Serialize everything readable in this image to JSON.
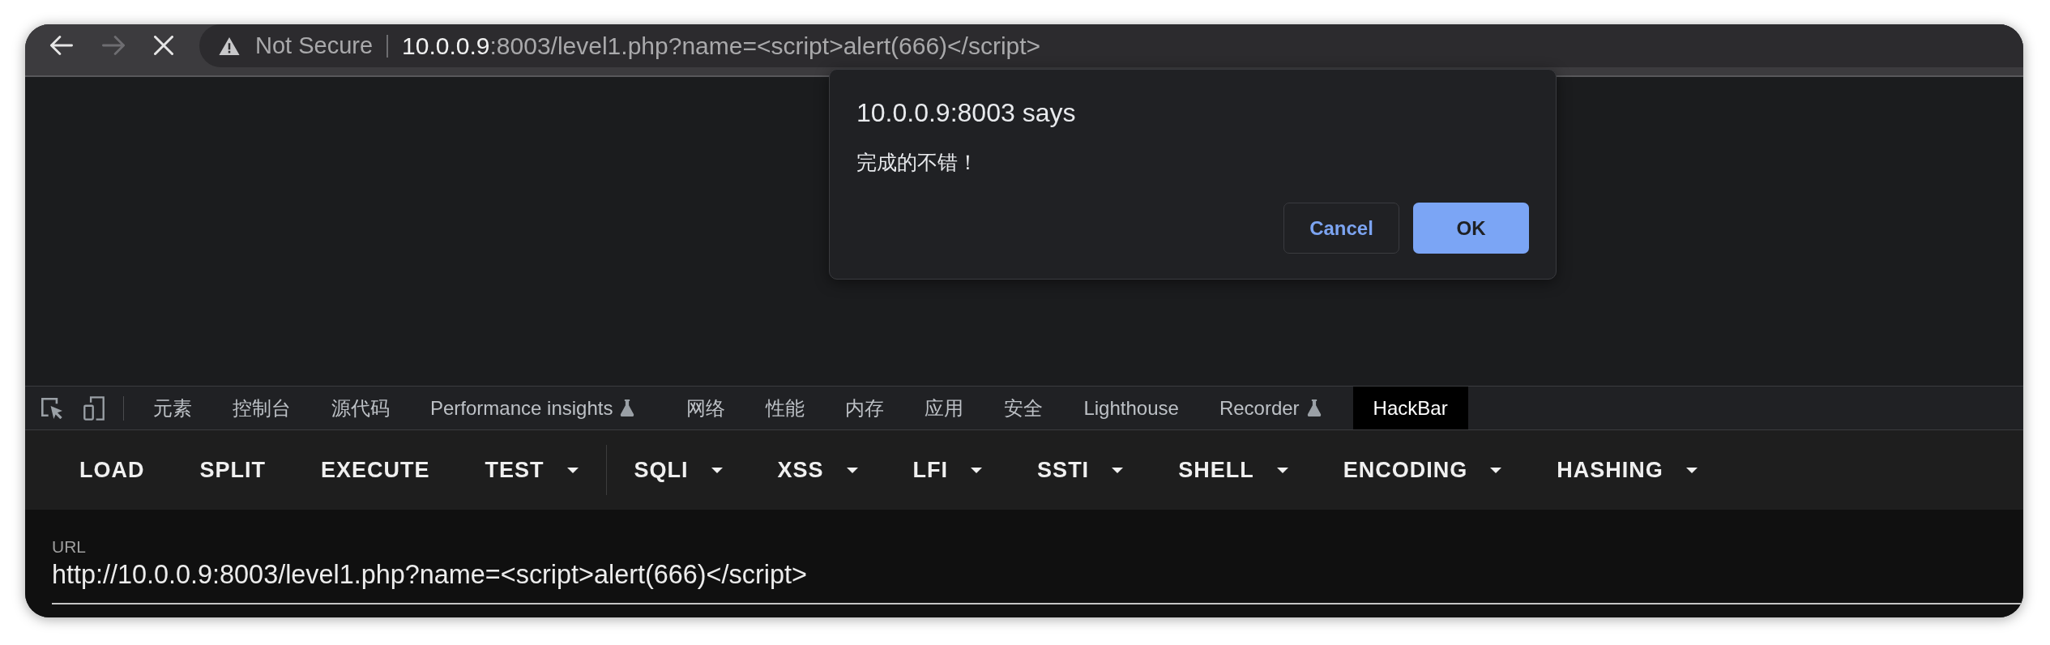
{
  "toolbar": {
    "buttons": [
      {
        "kind": "back",
        "disabled": false
      },
      {
        "kind": "forward",
        "disabled": true
      },
      {
        "kind": "stop",
        "disabled": false
      }
    ],
    "address_bar": {
      "security_label": "Not Secure",
      "host": "10.0.0.9",
      "path": ":8003/level1.php?name=<script>alert(666)</script>"
    }
  },
  "dialog": {
    "title": "10.0.0.9:8003 says",
    "message": "完成的不错！",
    "buttons": [
      {
        "label": "Cancel",
        "kind": "cancel"
      },
      {
        "label": "OK",
        "kind": "confirm"
      }
    ]
  },
  "devtools": {
    "tabs": [
      {
        "label": "元素",
        "selected": false,
        "experimental": false
      },
      {
        "label": "控制台",
        "selected": false,
        "experimental": false
      },
      {
        "label": "源代码",
        "selected": false,
        "experimental": false
      },
      {
        "label": "Performance insights",
        "selected": false,
        "experimental": true
      },
      {
        "label": "网络",
        "selected": false,
        "experimental": false
      },
      {
        "label": "性能",
        "selected": false,
        "experimental": false
      },
      {
        "label": "内存",
        "selected": false,
        "experimental": false
      },
      {
        "label": "应用",
        "selected": false,
        "experimental": false
      },
      {
        "label": "安全",
        "selected": false,
        "experimental": false
      },
      {
        "label": "Lighthouse",
        "selected": false,
        "experimental": false
      },
      {
        "label": "Recorder",
        "selected": false,
        "experimental": true
      },
      {
        "label": "HackBar",
        "selected": true,
        "experimental": false
      }
    ]
  },
  "hackbar": {
    "groups": [
      {
        "buttons": [
          {
            "label": "LOAD",
            "dropdown": false
          },
          {
            "label": "SPLIT",
            "dropdown": false
          },
          {
            "label": "EXECUTE",
            "dropdown": false
          },
          {
            "label": "TEST",
            "dropdown": true
          }
        ]
      },
      {
        "buttons": [
          {
            "label": "SQLI",
            "dropdown": true
          },
          {
            "label": "XSS",
            "dropdown": true
          },
          {
            "label": "LFI",
            "dropdown": true
          },
          {
            "label": "SSTI",
            "dropdown": true
          },
          {
            "label": "SHELL",
            "dropdown": true
          },
          {
            "label": "ENCODING",
            "dropdown": true
          },
          {
            "label": "HASHING",
            "dropdown": true
          }
        ]
      }
    ]
  },
  "url_panel": {
    "label": "URL",
    "value": "http://10.0.0.9:8003/level1.php?name=<script>alert(666)</script>"
  }
}
